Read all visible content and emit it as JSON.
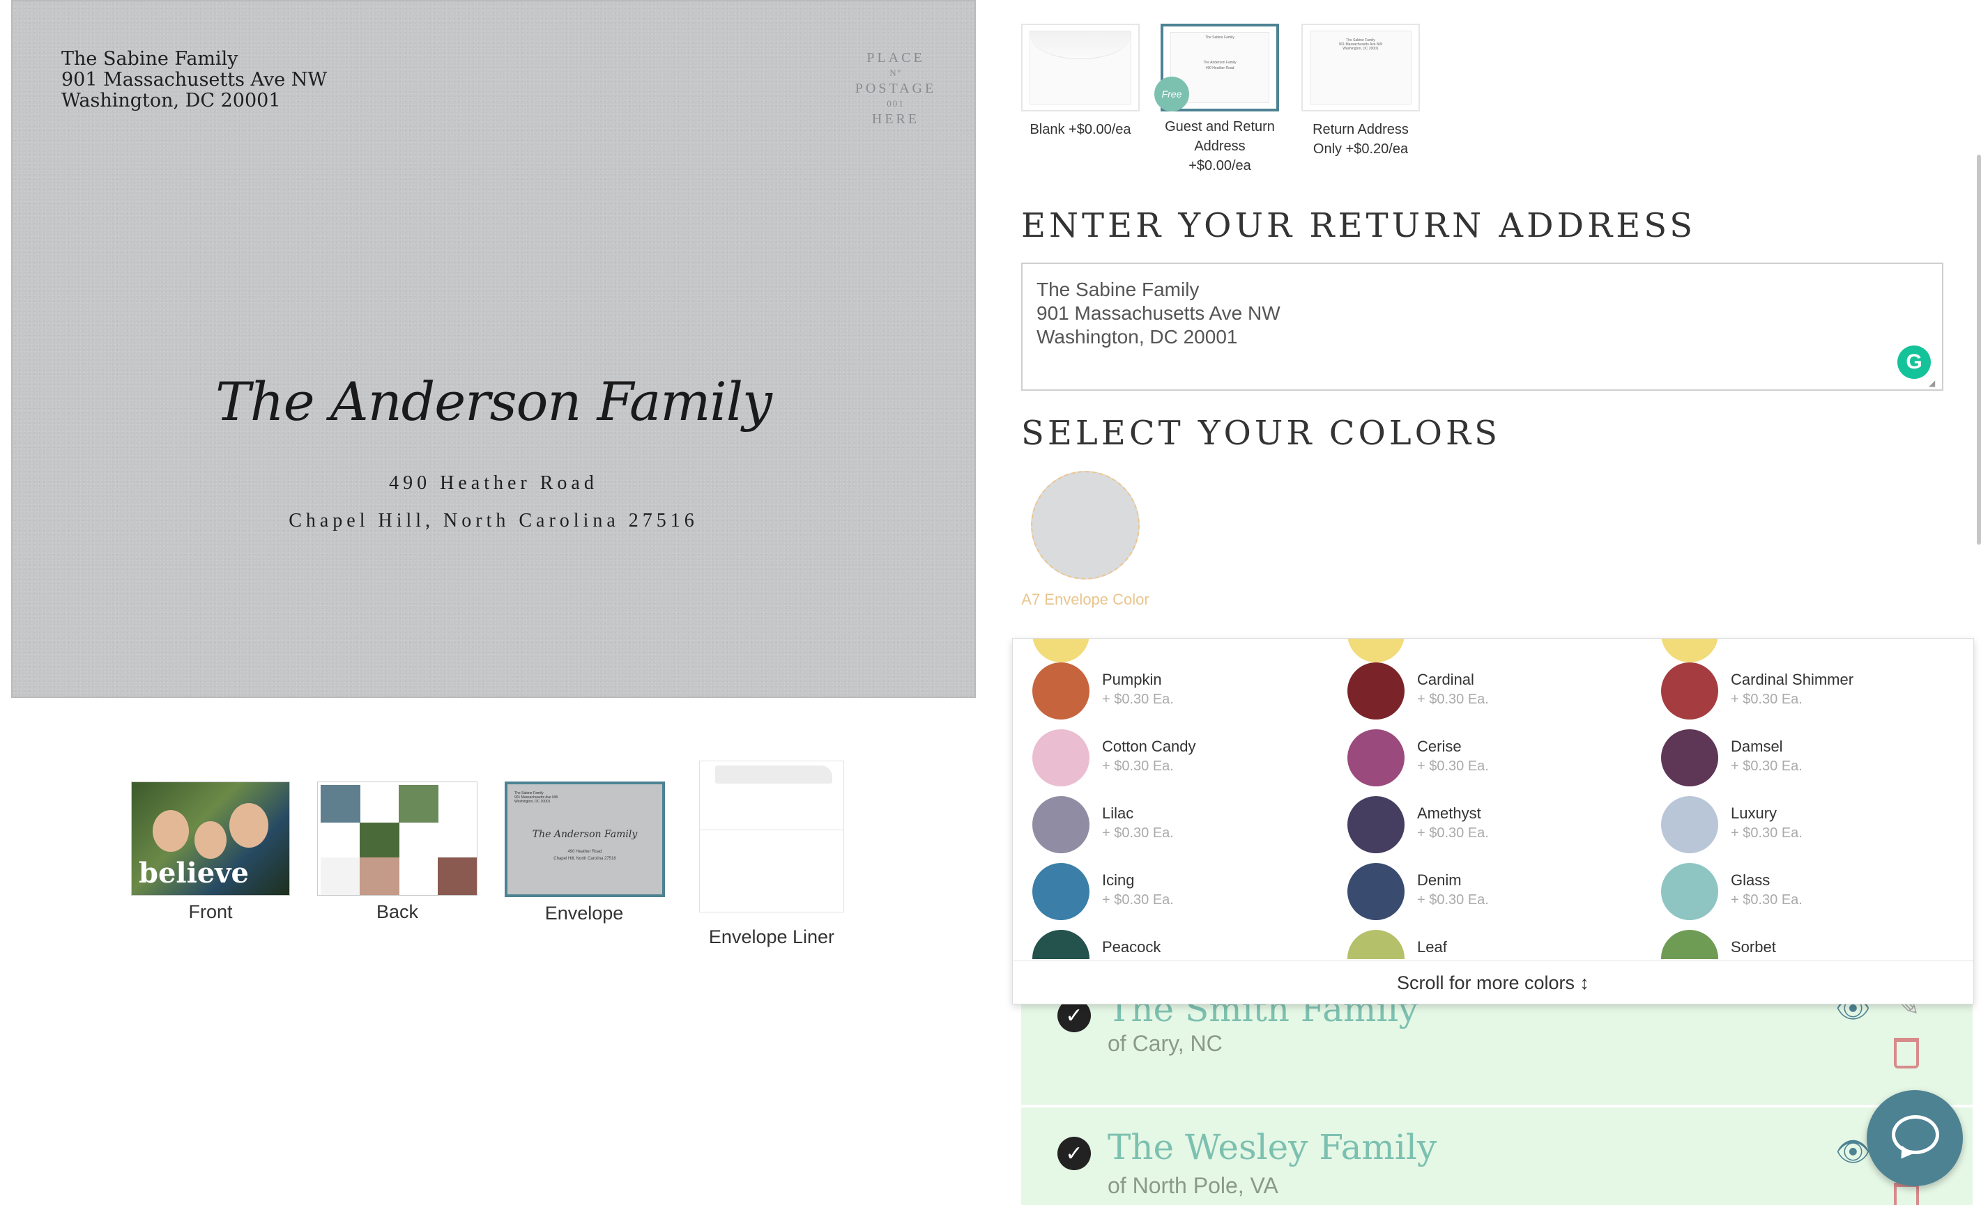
{
  "envelope_preview": {
    "return_address": [
      "The Sabine Family",
      "901 Massachusetts Ave NW",
      "Washington, DC 20001"
    ],
    "stamp_text": [
      "PLACE",
      "Nº",
      "POSTAGE",
      "001",
      "HERE"
    ],
    "recipient_name": "The Anderson Family",
    "recipient_line1": "490 Heather Road",
    "recipient_line2": "Chapel Hill, North Carolina 27516"
  },
  "thumbnails": {
    "front_label": "Front",
    "front_overlay": "believe",
    "back_label": "Back",
    "envelope_label": "Envelope",
    "liner_label": "Envelope Liner"
  },
  "addressing_options": [
    {
      "label_lines": [
        "Blank +$0.00/ea"
      ],
      "selected": false
    },
    {
      "label_lines": [
        "Guest and Return",
        "Address",
        "+$0.00/ea"
      ],
      "selected": true,
      "badge": "Free"
    },
    {
      "label_lines": [
        "Return Address",
        "Only +$0.20/ea"
      ],
      "selected": false
    }
  ],
  "return_address_section": {
    "heading": "ENTER YOUR RETURN ADDRESS",
    "value": "The Sabine Family\n901 Massachusetts Ave NW\nWashington, DC 20001"
  },
  "colors_section": {
    "heading": "SELECT YOUR COLORS",
    "current_swatch_label": "A7 Envelope Color",
    "current_swatch_color": "#d9dbdd",
    "options": [
      {
        "name": "Pumpkin",
        "price": "+ $0.30 Ea.",
        "color": "#c6653d"
      },
      {
        "name": "Cardinal",
        "price": "+ $0.30 Ea.",
        "color": "#7a2429"
      },
      {
        "name": "Cardinal Shimmer",
        "price": "+ $0.30 Ea.",
        "color": "#a53d40"
      },
      {
        "name": "Cotton Candy",
        "price": "+ $0.30 Ea.",
        "color": "#ebbdd0"
      },
      {
        "name": "Cerise",
        "price": "+ $0.30 Ea.",
        "color": "#9b4a7d"
      },
      {
        "name": "Damsel",
        "price": "+ $0.30 Ea.",
        "color": "#5e3656"
      },
      {
        "name": "Lilac",
        "price": "+ $0.30 Ea.",
        "color": "#908ca3"
      },
      {
        "name": "Amethyst",
        "price": "+ $0.30 Ea.",
        "color": "#453e60"
      },
      {
        "name": "Luxury",
        "price": "+ $0.30 Ea.",
        "color": "#b8c6d8"
      },
      {
        "name": "Icing",
        "price": "+ $0.30 Ea.",
        "color": "#3b7fa8"
      },
      {
        "name": "Denim",
        "price": "+ $0.30 Ea.",
        "color": "#3a4b70"
      },
      {
        "name": "Glass",
        "price": "+ $0.30 Ea.",
        "color": "#8ec5c3"
      },
      {
        "name": "Peacock",
        "price": "",
        "color": "#24524c"
      },
      {
        "name": "Leaf",
        "price": "",
        "color": "#b5c16a"
      },
      {
        "name": "Sorbet",
        "price": "",
        "color": "#6f9c55"
      }
    ],
    "partial_row_color": "#f2dc7a",
    "scroll_hint": "Scroll for more colors ↕"
  },
  "family_cards": [
    {
      "name": "The Smith Family",
      "location": "of Cary, NC"
    },
    {
      "name": "The Wesley Family",
      "location": "of North Pole, VA"
    }
  ],
  "colors": {
    "accent": "#4d8293",
    "free_badge": "#7cc0b0",
    "card_bg": "#e5f7e5"
  }
}
